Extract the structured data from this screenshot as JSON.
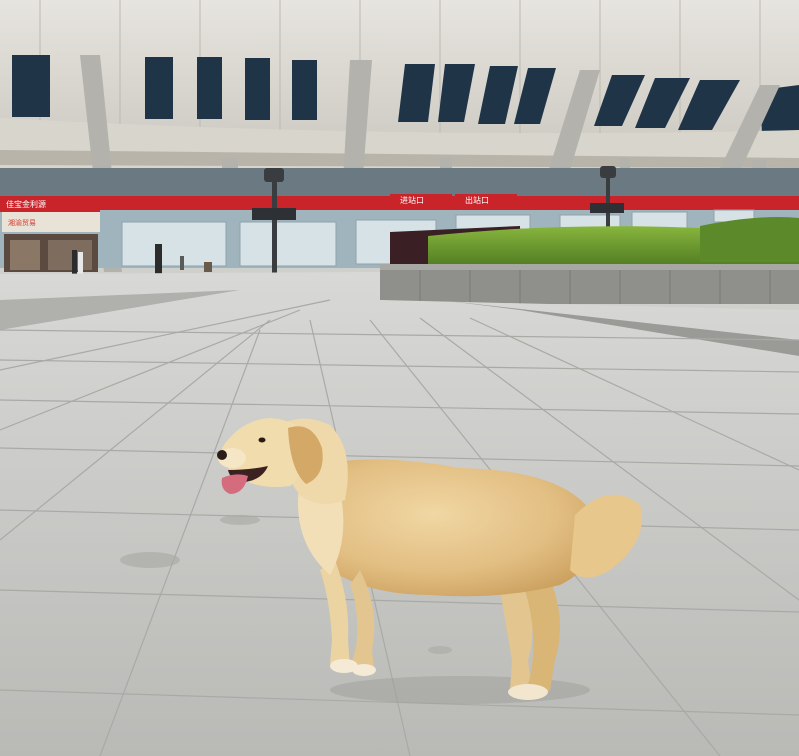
{
  "signs": {
    "store_top": "佳宝金利源",
    "store_bottom": "湘渝贸易",
    "entrance_left": "进站口",
    "entrance_right": "出站口"
  },
  "colors": {
    "sky_roof": "#dedbd4",
    "stripe": "#1f3447",
    "banner_red": "#c9242a",
    "pavement": "#c4c4c1",
    "hedge": "#6f9b2e",
    "dog_fur": "#e4c48a"
  }
}
